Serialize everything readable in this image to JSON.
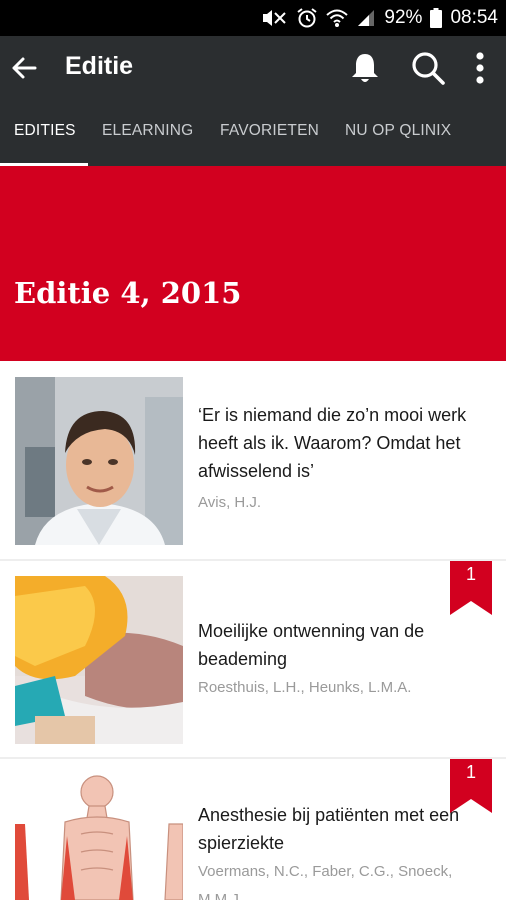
{
  "status": {
    "battery": "92%",
    "time": "08:54"
  },
  "toolbar": {
    "title": "Editie"
  },
  "tabs": [
    {
      "label": "EDITIES"
    },
    {
      "label": "ELEARNING"
    },
    {
      "label": "FAVORIETEN"
    },
    {
      "label": "NU OP QLINIX"
    }
  ],
  "hero": {
    "title": "Editie 4, 2015"
  },
  "articles": [
    {
      "title": "‘Er is niemand die zo’n mooi werk heeft als ik. Waarom? Omdat het afwisselend is’",
      "author": "Avis, H.J.",
      "badge": ""
    },
    {
      "title": "Moeilijke ontwenning van de beademing",
      "author": "Roesthuis, L.H., Heunks, L.M.A.",
      "badge": "1"
    },
    {
      "title": "Anesthesie bij patiënten met een spierziekte",
      "author": "Voermans, N.C., Faber, C.G., Snoeck, M.M.J.",
      "badge": "1"
    }
  ],
  "colors": {
    "appbar": "#2b2e30",
    "accent": "#d2001f"
  }
}
